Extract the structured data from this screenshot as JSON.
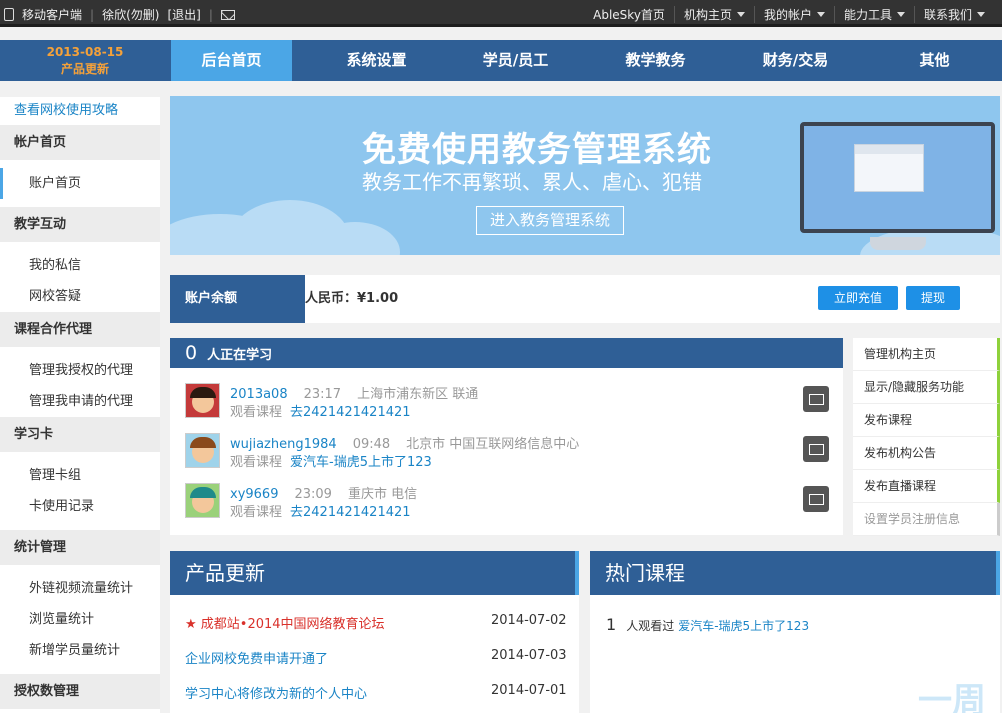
{
  "topbar": {
    "mobile": "移动客户端",
    "user": "徐欣(勿删)",
    "logout": "[退出]",
    "links": [
      "AbleSky首页",
      "机构主页",
      "我的帐户",
      "能力工具",
      "联系我们"
    ]
  },
  "nav": {
    "date": "2013-08-15",
    "update": "产品更新",
    "tabs": [
      "后台首页",
      "系统设置",
      "学员/员工",
      "教学教务",
      "财务/交易",
      "其他"
    ]
  },
  "sidebar": {
    "guide": "查看网校使用攻略",
    "groups": [
      {
        "title": "帐户首页",
        "items": [
          "账户首页"
        ]
      },
      {
        "title": "教学互动",
        "items": [
          "我的私信",
          "网校答疑"
        ]
      },
      {
        "title": "课程合作代理",
        "items": [
          "管理我授权的代理",
          "管理我申请的代理"
        ]
      },
      {
        "title": "学习卡",
        "items": [
          "管理卡组",
          "卡使用记录"
        ]
      },
      {
        "title": "统计管理",
        "items": [
          "外链视频流量统计",
          "浏览量统计",
          "新增学员量统计"
        ]
      },
      {
        "title": "授权数管理",
        "items": []
      }
    ]
  },
  "banner": {
    "title": "免费使用教务管理系统",
    "subtitle": "教务工作不再繁琐、累人、虐心、犯错",
    "button": "进入教务管理系统"
  },
  "balance": {
    "label": "账户余额",
    "amount": "人民币：¥1.00",
    "recharge": "立即充值",
    "withdraw": "提现"
  },
  "learning": {
    "count": "0",
    "title": "人正在学习",
    "rows": [
      {
        "user": "2013a08",
        "time": "23:17",
        "location": "上海市浦东新区 联通",
        "action": "观看课程",
        "course": "去2421421421421"
      },
      {
        "user": "wujiazheng1984",
        "time": "09:48",
        "location": "北京市 中国互联网络信息中心",
        "action": "观看课程",
        "course": "爱汽车-瑞虎5上市了123"
      },
      {
        "user": "xy9669",
        "time": "23:09",
        "location": "重庆市 电信",
        "action": "观看课程",
        "course": "去2421421421421"
      }
    ]
  },
  "right_menu": [
    "管理机构主页",
    "显示/隐藏服务功能",
    "发布课程",
    "发布机构公告",
    "发布直播课程",
    "设置学员注册信息"
  ],
  "product_updates": {
    "title": "产品更新",
    "items": [
      {
        "text": "★ 成都站•2014中国网络教育论坛",
        "date": "2014-07-02",
        "color": "#d9312b"
      },
      {
        "text": "企业网校免费申请开通了",
        "date": "2014-07-03",
        "color": "#1a84c6"
      },
      {
        "text": "学习中心将修改为新的个人中心",
        "date": "2014-07-01",
        "color": "#1a84c6"
      }
    ]
  },
  "hot_courses": {
    "title": "热门课程",
    "num": "1",
    "text": "人观看过",
    "course": "爱汽车-瑞虎5上市了123"
  },
  "watermark": "一周"
}
